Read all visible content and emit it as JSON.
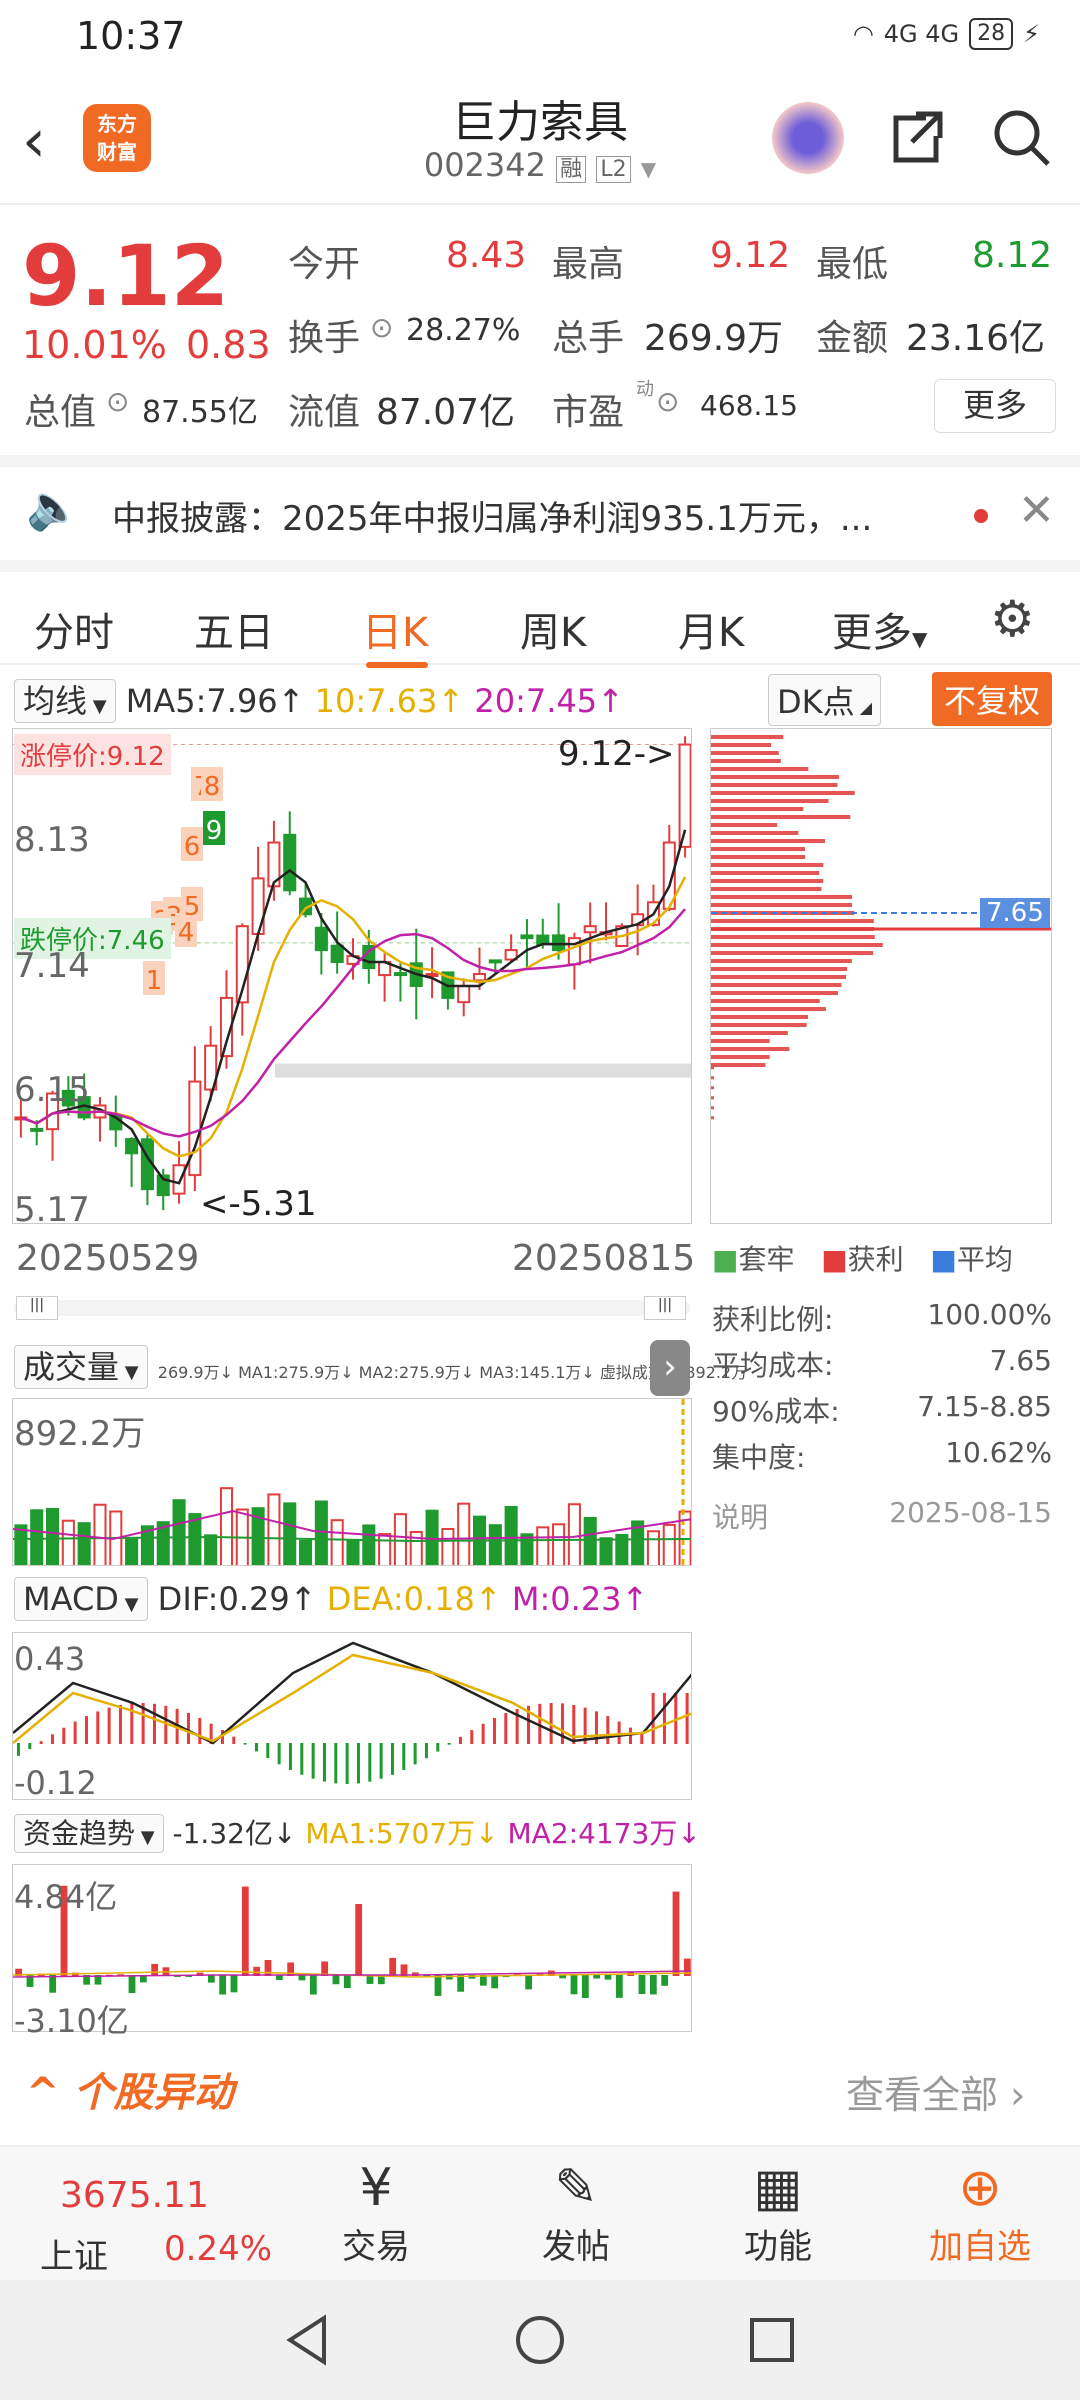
{
  "status": {
    "time": "10:37",
    "signal": "4G 4G",
    "battery": "28"
  },
  "header": {
    "title": "巨力索具",
    "code": "002342",
    "tag1": "融",
    "tag2": "L2",
    "logo": "东方\n财富"
  },
  "quote": {
    "price": "9.12",
    "pct": "10.01%",
    "change": "0.83",
    "fields": [
      {
        "label": "今开",
        "value": "8.43",
        "color": "red"
      },
      {
        "label": "最高",
        "value": "9.12",
        "color": "red"
      },
      {
        "label": "最低",
        "value": "8.12",
        "color": "green"
      },
      {
        "label": "换手",
        "value": "28.27%"
      },
      {
        "label": "总手",
        "value": "269.9万"
      },
      {
        "label": "金额",
        "value": "23.16亿"
      },
      {
        "label": "总值",
        "value": "87.55亿"
      },
      {
        "label": "流值",
        "value": "87.07亿"
      },
      {
        "label": "市盈",
        "value": "468.15",
        "sup": "动"
      }
    ],
    "more": "更多"
  },
  "notice": {
    "text": "中报披露：2025年中报归属净利润935.1万元，..."
  },
  "tabs": [
    "分时",
    "五日",
    "日K",
    "周K",
    "月K",
    "更多"
  ],
  "active_tab": "日K",
  "kline": {
    "ma_select": "均线",
    "ma5": "MA5:7.96↑",
    "ma10": "10:7.63↑",
    "ma20": "20:7.45↑",
    "dk": "DK点",
    "fq": "不复权",
    "limit_up": "涨停价:9.12",
    "limit_down": "跌停价:7.46",
    "y_labels": [
      "9.12",
      "8.13",
      "7.14",
      "6.15",
      "5.17"
    ],
    "hi_mark": "9.12->",
    "lo_mark": "<-5.31",
    "date_start": "20250529",
    "date_end": "20250815",
    "num_labels": [
      "1",
      "2",
      "3",
      "4",
      "5",
      "6",
      "7",
      "8",
      "9"
    ]
  },
  "chip": {
    "avg_label": "7.65",
    "legend": [
      "套牢",
      "获利",
      "平均"
    ],
    "rows": [
      {
        "k": "获利比例:",
        "v": "100.00%"
      },
      {
        "k": "平均成本:",
        "v": "7.65"
      },
      {
        "k": "90%成本:",
        "v": "7.15-8.85"
      },
      {
        "k": "集中度:",
        "v": "10.62%"
      }
    ],
    "note": "说明",
    "date": "2025-08-15"
  },
  "volume": {
    "select": "成交量",
    "info": "269.9万↓ MA1:275.9万↓ MA2:275.9万↓ MA3:145.1万↓ 虚拟成交量:892.2万",
    "top": "892.2万"
  },
  "macd": {
    "select": "MACD",
    "dif": "DIF:0.29↑",
    "dea": "DEA:0.18↑",
    "m": "M:0.23↑",
    "top": "0.43",
    "bottom": "-0.12"
  },
  "fund": {
    "select": "资金趋势",
    "v": "-1.32亿↓",
    "ma1": "MA1:5707万↓",
    "ma2": "MA2:4173万↓",
    "top": "4.84亿",
    "bottom": "-3.10亿"
  },
  "movement": {
    "title": "个股异动",
    "all": "查看全部"
  },
  "bottom": {
    "index_value": "3675.11",
    "index_name": "上证",
    "index_pct": "0.24%",
    "items": [
      {
        "label": "交易",
        "icon": "trade-icon"
      },
      {
        "label": "发帖",
        "icon": "post-icon"
      },
      {
        "label": "功能",
        "icon": "apps-icon"
      },
      {
        "label": "加自选",
        "icon": "add-icon"
      }
    ]
  }
}
